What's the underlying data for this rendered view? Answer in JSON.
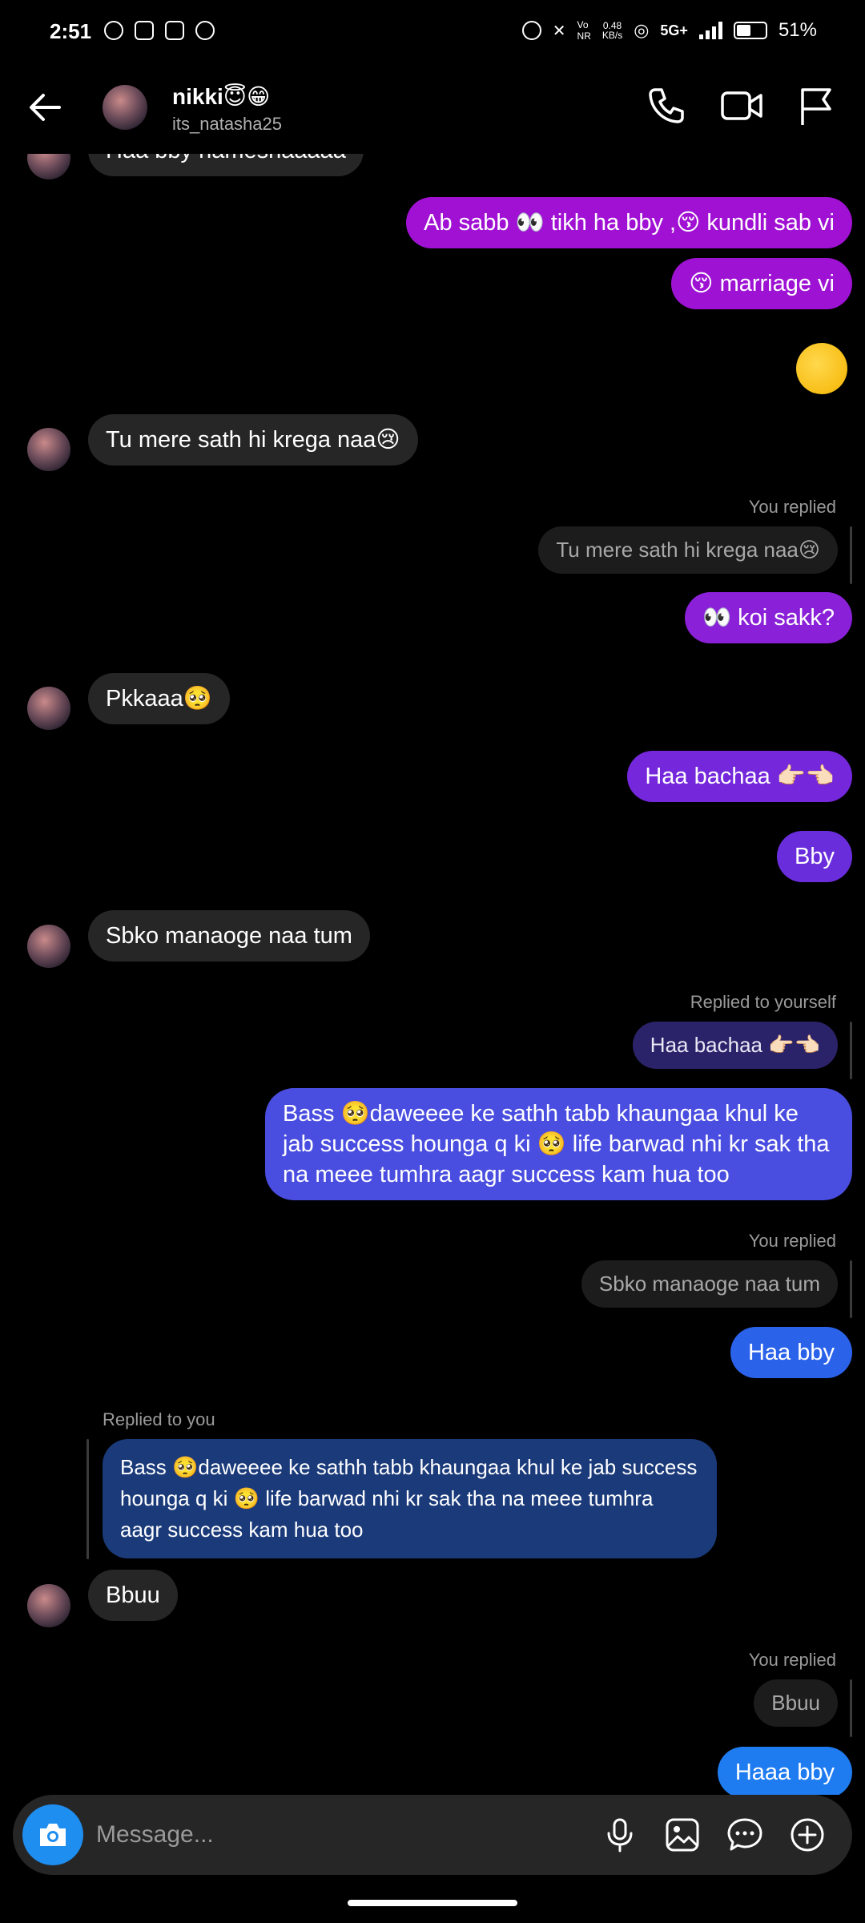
{
  "status_bar": {
    "time": "2:51",
    "network_speed_top": "0.48",
    "network_speed_bottom": "KB/s",
    "network": "5G+",
    "battery": "51%",
    "battery_level": 0.51
  },
  "header": {
    "name": "nikki😇😁",
    "username": "its_natasha25"
  },
  "messages": {
    "m0": "Haa bby hameshaaaaa",
    "m1": "Ab sabb 👀 tikh ha bby ,😚 kundli sab vi",
    "m2": "😚 marriage vi",
    "m3": "😚",
    "m4": "Tu mere sath hi krega naa😢",
    "m5_label": "You replied",
    "m5_quote": "Tu mere sath hi krega naa😢",
    "m5": "👀 koi sakk?",
    "m6": "Pkkaaa🥺",
    "m7": "Haa bachaa 👉🏻👈🏻",
    "m8": "Bby",
    "m9": "Sbko manaoge naa tum",
    "m10_label": "Replied to yourself",
    "m10_quote": "Haa bachaa 👉🏻👈🏻",
    "m10": "Bass 🥺daweeee ke sathh tabb khaungaa khul ke jab success hounga q ki 🥺 life barwad nhi kr sak tha na meee tumhra aagr success kam hua too",
    "m11_label": "You replied",
    "m11_quote": "Sbko manaoge naa tum",
    "m11": "Haa bby",
    "m12_label": "Replied to you",
    "m12_quote": "Bass 🥺daweeee ke sathh tabb khaungaa khul ke jab success hounga q ki 🥺 life barwad nhi kr sak tha na meee tumhra aagr success kam hua too",
    "m13": "Bbuu",
    "m14_label": "You replied",
    "m14_quote": "Bbuu",
    "m14": "Haaa bby"
  },
  "composer": {
    "placeholder": "Message..."
  },
  "colors": {
    "sent_gradient_top": "#a011d3",
    "sent_gradient_bottom": "#1f7cf0",
    "received": "#262626",
    "camera_button": "#1f8ef1"
  },
  "icons": [
    "back-arrow-icon",
    "phone-icon",
    "video-icon",
    "flag-icon",
    "camera-icon",
    "microphone-icon",
    "gallery-icon",
    "sticker-icon",
    "plus-icon"
  ]
}
